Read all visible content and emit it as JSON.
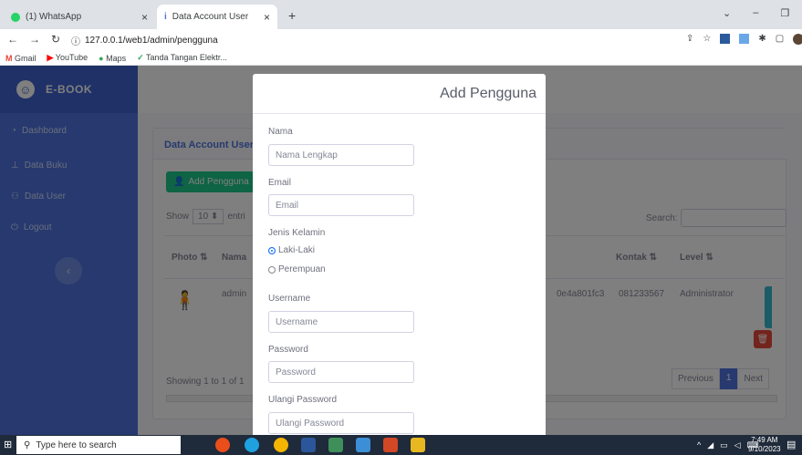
{
  "browser": {
    "tabs": [
      {
        "title": "(1) WhatsApp",
        "close": "×"
      },
      {
        "title": "Data Account User",
        "close": "×"
      }
    ],
    "new_tab": "+",
    "url": "127.0.0.1/web1/admin/pengguna",
    "bookmarks": [
      "Gmail",
      "YouTube",
      "Maps",
      "Tanda Tangan Elektr..."
    ]
  },
  "sidebar": {
    "brand": "E-BOOK",
    "items": [
      {
        "label": "Dashboard",
        "icon": "dashboard-icon"
      },
      {
        "label": "Data Buku",
        "icon": "book-icon"
      },
      {
        "label": "Data User",
        "icon": "users-icon"
      },
      {
        "label": "Logout",
        "icon": "logout-icon"
      }
    ],
    "collapse": "‹"
  },
  "card": {
    "title": "Data Account User",
    "add_button": "Add Pengguna",
    "show_label": "Show",
    "show_value": "10",
    "entries_label": "entri",
    "search_label": "Search:",
    "columns": [
      "Photo",
      "Nama",
      "Kontak",
      "Level"
    ],
    "row": {
      "name": "admin",
      "hash": "0e4a801fc3",
      "kontak": "081233567",
      "level": "Administrator"
    },
    "footer": "Showing 1 to 1 of 1",
    "pager": {
      "previous": "Previous",
      "page": "1",
      "next": "Next"
    }
  },
  "modal": {
    "title": "Add Pengguna",
    "nama_label": "Nama",
    "nama_placeholder": "Nama Lengkap",
    "email_label": "Email",
    "email_placeholder": "Email",
    "gender_label": "Jenis Kelamin",
    "gender_options": [
      "Laki-Laki",
      "Perempuan"
    ],
    "username_label": "Username",
    "username_placeholder": "Username",
    "password_label": "Password",
    "password_placeholder": "Password",
    "repassword_label": "Ulangi Password",
    "repassword_placeholder": "Ulangi Password"
  },
  "taskbar": {
    "search_placeholder": "Type here to search",
    "time": "7:49 AM",
    "date": "9/10/2023"
  },
  "colors": {
    "primary": "#4e73df",
    "success": "#1cc88a",
    "danger": "#e74a3b",
    "teal": "#36b9cc"
  }
}
